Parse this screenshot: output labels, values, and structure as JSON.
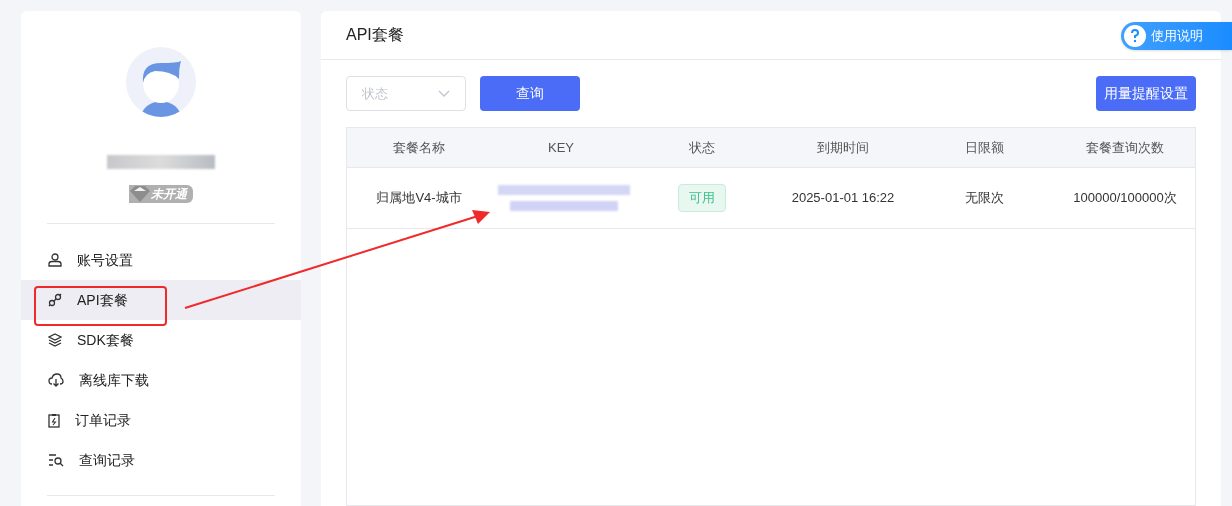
{
  "sidebar": {
    "badge": "未开通",
    "menu": [
      {
        "label": "账号设置",
        "selected": false
      },
      {
        "label": "API套餐",
        "selected": true
      },
      {
        "label": "SDK套餐",
        "selected": false
      },
      {
        "label": "离线库下载",
        "selected": false
      },
      {
        "label": "订单记录",
        "selected": false
      },
      {
        "label": "查询记录",
        "selected": false
      }
    ]
  },
  "main": {
    "title": "API套餐",
    "help_button": "使用说明",
    "filter": {
      "placeholder": "状态"
    },
    "query_button": "查询",
    "alert_button": "用量提醒设置",
    "table": {
      "columns": [
        "套餐名称",
        "KEY",
        "状态",
        "到期时间",
        "日限额",
        "套餐查询次数"
      ],
      "rows": [
        {
          "name": "归属地V4-城市",
          "status": "可用",
          "expires": "2025-01-01 16:22",
          "daily_limit": "无限次",
          "queries": "100000/100000次"
        }
      ]
    }
  }
}
